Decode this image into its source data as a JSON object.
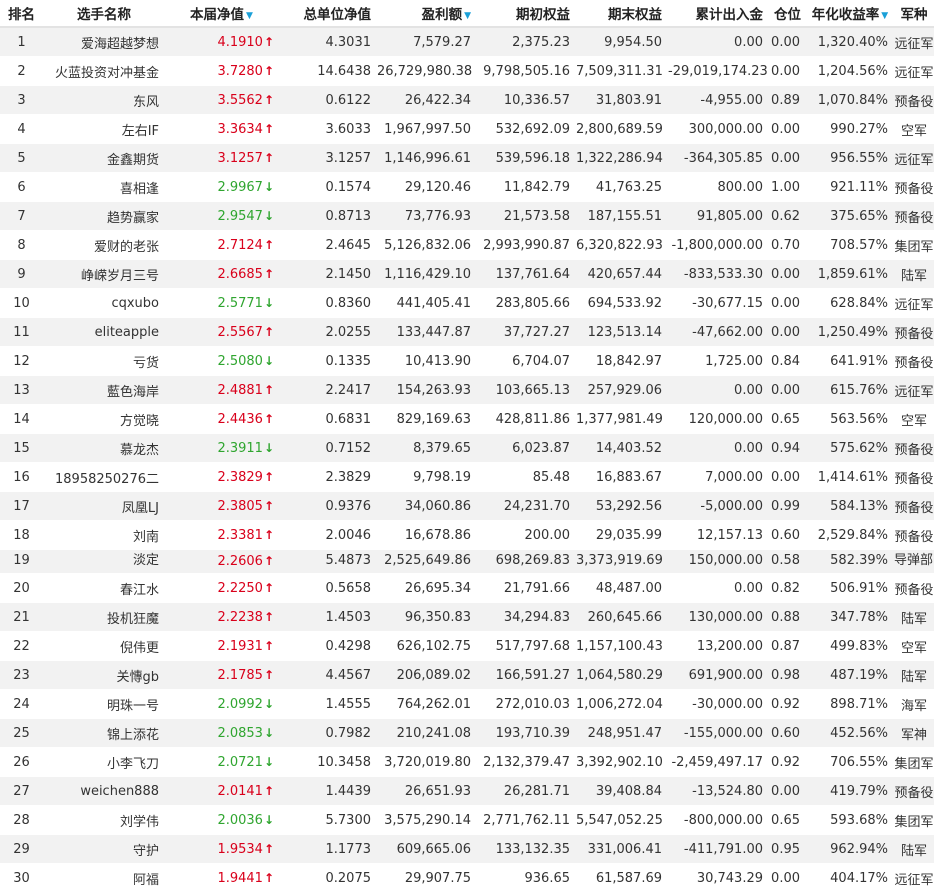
{
  "colors": {
    "up": "#d9001b",
    "down": "#2fa52f",
    "sort_arrow": "#1aa0d8",
    "row_alt": "#f2f2f2"
  },
  "headers": {
    "rank": "排名",
    "player": "选手名称",
    "nav": "本届净值",
    "total_nav": "总单位净值",
    "profit": "盈利额",
    "start_equity": "期初权益",
    "end_equity": "期末权益",
    "net_flow": "累计出入金",
    "position": "仓位",
    "annual_return": "年化收益率",
    "branch": "军种"
  },
  "sort_icon": "▼",
  "rows": [
    {
      "rank": "1",
      "name": "爱海超越梦想",
      "nav": "4.1910",
      "dir": "up",
      "total_nav": "4.3031",
      "profit": "7,579.27",
      "start": "2,375.23",
      "end": "9,954.50",
      "flow": "0.00",
      "pos": "0.00",
      "annual": "1,320.40%",
      "branch": "远征军"
    },
    {
      "rank": "2",
      "name": "火蓝投资对冲基金",
      "nav": "3.7280",
      "dir": "up",
      "total_nav": "14.6438",
      "profit": "26,729,980.38",
      "start": "9,798,505.16",
      "end": "7,509,311.31",
      "flow": "-29,019,174.23",
      "pos": "0.00",
      "annual": "1,204.56%",
      "branch": "远征军"
    },
    {
      "rank": "3",
      "name": "东风",
      "nav": "3.5562",
      "dir": "up",
      "total_nav": "0.6122",
      "profit": "26,422.34",
      "start": "10,336.57",
      "end": "31,803.91",
      "flow": "-4,955.00",
      "pos": "0.89",
      "annual": "1,070.84%",
      "branch": "预备役"
    },
    {
      "rank": "4",
      "name": "左右IF",
      "nav": "3.3634",
      "dir": "up",
      "total_nav": "3.6033",
      "profit": "1,967,997.50",
      "start": "532,692.09",
      "end": "2,800,689.59",
      "flow": "300,000.00",
      "pos": "0.00",
      "annual": "990.27%",
      "branch": "空军"
    },
    {
      "rank": "5",
      "name": "金鑫期货",
      "nav": "3.1257",
      "dir": "up",
      "total_nav": "3.1257",
      "profit": "1,146,996.61",
      "start": "539,596.18",
      "end": "1,322,286.94",
      "flow": "-364,305.85",
      "pos": "0.00",
      "annual": "956.55%",
      "branch": "远征军"
    },
    {
      "rank": "6",
      "name": "喜相逢",
      "nav": "2.9967",
      "dir": "down",
      "total_nav": "0.1574",
      "profit": "29,120.46",
      "start": "11,842.79",
      "end": "41,763.25",
      "flow": "800.00",
      "pos": "1.00",
      "annual": "921.11%",
      "branch": "预备役"
    },
    {
      "rank": "7",
      "name": "趋势赢家",
      "nav": "2.9547",
      "dir": "down",
      "total_nav": "0.8713",
      "profit": "73,776.93",
      "start": "21,573.58",
      "end": "187,155.51",
      "flow": "91,805.00",
      "pos": "0.62",
      "annual": "375.65%",
      "branch": "预备役"
    },
    {
      "rank": "8",
      "name": "爱财的老张",
      "nav": "2.7124",
      "dir": "up",
      "total_nav": "2.4645",
      "profit": "5,126,832.06",
      "start": "2,993,990.87",
      "end": "6,320,822.93",
      "flow": "-1,800,000.00",
      "pos": "0.70",
      "annual": "708.57%",
      "branch": "集团军"
    },
    {
      "rank": "9",
      "name": "峥嵘岁月三号",
      "nav": "2.6685",
      "dir": "up",
      "total_nav": "2.1450",
      "profit": "1,116,429.10",
      "start": "137,761.64",
      "end": "420,657.44",
      "flow": "-833,533.30",
      "pos": "0.00",
      "annual": "1,859.61%",
      "branch": "陆军"
    },
    {
      "rank": "10",
      "name": "cqxubo",
      "nav": "2.5771",
      "dir": "down",
      "total_nav": "0.8360",
      "profit": "441,405.41",
      "start": "283,805.66",
      "end": "694,533.92",
      "flow": "-30,677.15",
      "pos": "0.00",
      "annual": "628.84%",
      "branch": "远征军"
    },
    {
      "rank": "11",
      "name": "eliteapple",
      "nav": "2.5567",
      "dir": "up",
      "total_nav": "2.0255",
      "profit": "133,447.87",
      "start": "37,727.27",
      "end": "123,513.14",
      "flow": "-47,662.00",
      "pos": "0.00",
      "annual": "1,250.49%",
      "branch": "预备役"
    },
    {
      "rank": "12",
      "name": "亏货",
      "nav": "2.5080",
      "dir": "down",
      "total_nav": "0.1335",
      "profit": "10,413.90",
      "start": "6,704.07",
      "end": "18,842.97",
      "flow": "1,725.00",
      "pos": "0.84",
      "annual": "641.91%",
      "branch": "预备役"
    },
    {
      "rank": "13",
      "name": "藍色海岸",
      "nav": "2.4881",
      "dir": "up",
      "total_nav": "2.2417",
      "profit": "154,263.93",
      "start": "103,665.13",
      "end": "257,929.06",
      "flow": "0.00",
      "pos": "0.00",
      "annual": "615.76%",
      "branch": "远征军"
    },
    {
      "rank": "14",
      "name": "方觉晓",
      "nav": "2.4436",
      "dir": "up",
      "total_nav": "0.6831",
      "profit": "829,169.63",
      "start": "428,811.86",
      "end": "1,377,981.49",
      "flow": "120,000.00",
      "pos": "0.65",
      "annual": "563.56%",
      "branch": "空军"
    },
    {
      "rank": "15",
      "name": "慕龙杰",
      "nav": "2.3911",
      "dir": "down",
      "total_nav": "0.7152",
      "profit": "8,379.65",
      "start": "6,023.87",
      "end": "14,403.52",
      "flow": "0.00",
      "pos": "0.94",
      "annual": "575.62%",
      "branch": "预备役"
    },
    {
      "rank": "16",
      "name": "18958250276二",
      "nav": "2.3829",
      "dir": "up",
      "total_nav": "2.3829",
      "profit": "9,798.19",
      "start": "85.48",
      "end": "16,883.67",
      "flow": "7,000.00",
      "pos": "0.00",
      "annual": "1,414.61%",
      "branch": "预备役"
    },
    {
      "rank": "17",
      "name": "凤凰LJ",
      "nav": "2.3805",
      "dir": "up",
      "total_nav": "0.9376",
      "profit": "34,060.86",
      "start": "24,231.70",
      "end": "53,292.56",
      "flow": "-5,000.00",
      "pos": "0.99",
      "annual": "584.13%",
      "branch": "预备役"
    },
    {
      "rank": "18",
      "name": "刘南",
      "nav": "2.3381",
      "dir": "up",
      "total_nav": "2.0046",
      "profit": "16,678.86",
      "start": "200.00",
      "end": "29,035.99",
      "flow": "12,157.13",
      "pos": "0.60",
      "annual": "2,529.84%",
      "branch": "预备役"
    },
    {
      "rank": "19",
      "name": "淡定",
      "nav": "2.2606",
      "dir": "up",
      "total_nav": "5.4873",
      "profit": "2,525,649.86",
      "start": "698,269.83",
      "end": "3,373,919.69",
      "flow": "150,000.00",
      "pos": "0.58",
      "annual": "582.39%",
      "branch": "导弹部队"
    },
    {
      "rank": "20",
      "name": "春江水",
      "nav": "2.2250",
      "dir": "up",
      "total_nav": "0.5658",
      "profit": "26,695.34",
      "start": "21,791.66",
      "end": "48,487.00",
      "flow": "0.00",
      "pos": "0.82",
      "annual": "506.91%",
      "branch": "预备役"
    },
    {
      "rank": "21",
      "name": "投机狂魔",
      "nav": "2.2238",
      "dir": "up",
      "total_nav": "1.4503",
      "profit": "96,350.83",
      "start": "34,294.83",
      "end": "260,645.66",
      "flow": "130,000.00",
      "pos": "0.88",
      "annual": "347.78%",
      "branch": "陆军"
    },
    {
      "rank": "22",
      "name": "倪伟更",
      "nav": "2.1931",
      "dir": "up",
      "total_nav": "0.4298",
      "profit": "626,102.75",
      "start": "517,797.68",
      "end": "1,157,100.43",
      "flow": "13,200.00",
      "pos": "0.87",
      "annual": "499.83%",
      "branch": "空军"
    },
    {
      "rank": "23",
      "name": "关慱gb",
      "nav": "2.1785",
      "dir": "up",
      "total_nav": "4.4567",
      "profit": "206,089.02",
      "start": "166,591.27",
      "end": "1,064,580.29",
      "flow": "691,900.00",
      "pos": "0.98",
      "annual": "487.19%",
      "branch": "陆军"
    },
    {
      "rank": "24",
      "name": "明珠一号",
      "nav": "2.0992",
      "dir": "down",
      "total_nav": "1.4555",
      "profit": "764,262.01",
      "start": "272,010.03",
      "end": "1,006,272.04",
      "flow": "-30,000.00",
      "pos": "0.92",
      "annual": "898.71%",
      "branch": "海军"
    },
    {
      "rank": "25",
      "name": "锦上添花",
      "nav": "2.0853",
      "dir": "down",
      "total_nav": "0.7982",
      "profit": "210,241.08",
      "start": "193,710.39",
      "end": "248,951.47",
      "flow": "-155,000.00",
      "pos": "0.60",
      "annual": "452.56%",
      "branch": "军神"
    },
    {
      "rank": "26",
      "name": "小李飞刀",
      "nav": "2.0721",
      "dir": "down",
      "total_nav": "10.3458",
      "profit": "3,720,019.80",
      "start": "2,132,379.47",
      "end": "3,392,902.10",
      "flow": "-2,459,497.17",
      "pos": "0.92",
      "annual": "706.55%",
      "branch": "集团军"
    },
    {
      "rank": "27",
      "name": "weichen888",
      "nav": "2.0141",
      "dir": "up",
      "total_nav": "1.4439",
      "profit": "26,651.93",
      "start": "26,281.71",
      "end": "39,408.84",
      "flow": "-13,524.80",
      "pos": "0.00",
      "annual": "419.79%",
      "branch": "预备役"
    },
    {
      "rank": "28",
      "name": "刘学伟",
      "nav": "2.0036",
      "dir": "down",
      "total_nav": "5.7300",
      "profit": "3,575,290.14",
      "start": "2,771,762.11",
      "end": "5,547,052.25",
      "flow": "-800,000.00",
      "pos": "0.65",
      "annual": "593.68%",
      "branch": "集团军"
    },
    {
      "rank": "29",
      "name": "守护",
      "nav": "1.9534",
      "dir": "up",
      "total_nav": "1.1773",
      "profit": "609,665.06",
      "start": "133,132.35",
      "end": "331,006.41",
      "flow": "-411,791.00",
      "pos": "0.95",
      "annual": "962.94%",
      "branch": "陆军"
    },
    {
      "rank": "30",
      "name": "阿福",
      "nav": "1.9441",
      "dir": "up",
      "total_nav": "0.2075",
      "profit": "29,907.75",
      "start": "936.65",
      "end": "61,587.69",
      "flow": "30,743.29",
      "pos": "0.00",
      "annual": "404.17%",
      "branch": "远征军"
    }
  ]
}
